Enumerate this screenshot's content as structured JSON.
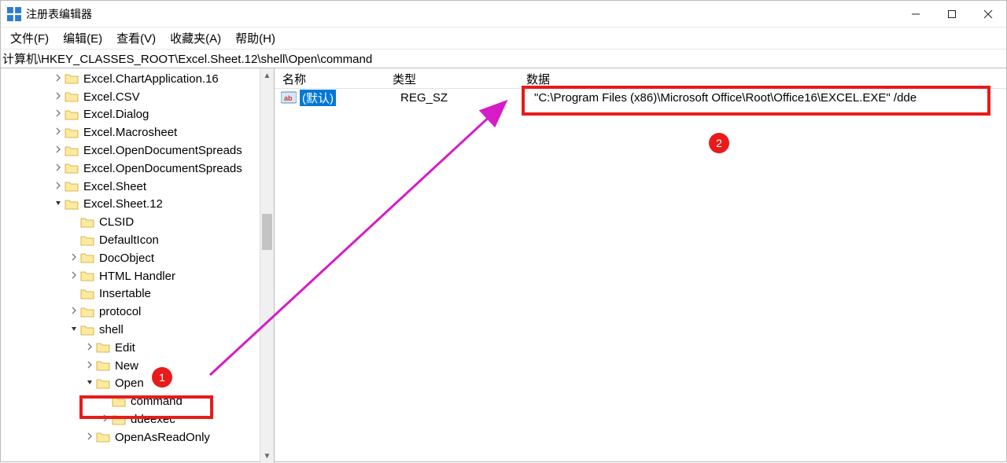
{
  "window": {
    "title": "注册表编辑器"
  },
  "menu": {
    "file": "文件(F)",
    "edit": "编辑(E)",
    "view": "查看(V)",
    "favorites": "收藏夹(A)",
    "help": "帮助(H)"
  },
  "address": {
    "path": "计算机\\HKEY_CLASSES_ROOT\\Excel.Sheet.12\\shell\\Open\\command"
  },
  "tree": [
    {
      "indent": 3,
      "arrow": ">",
      "label": "Excel.ChartApplication.16"
    },
    {
      "indent": 3,
      "arrow": ">",
      "label": "Excel.CSV"
    },
    {
      "indent": 3,
      "arrow": ">",
      "label": "Excel.Dialog"
    },
    {
      "indent": 3,
      "arrow": ">",
      "label": "Excel.Macrosheet"
    },
    {
      "indent": 3,
      "arrow": ">",
      "label": "Excel.OpenDocumentSpreads"
    },
    {
      "indent": 3,
      "arrow": ">",
      "label": "Excel.OpenDocumentSpreads"
    },
    {
      "indent": 3,
      "arrow": ">",
      "label": "Excel.Sheet"
    },
    {
      "indent": 3,
      "arrow": "v",
      "label": "Excel.Sheet.12"
    },
    {
      "indent": 4,
      "arrow": "",
      "label": "CLSID"
    },
    {
      "indent": 4,
      "arrow": "",
      "label": "DefaultIcon"
    },
    {
      "indent": 4,
      "arrow": ">",
      "label": "DocObject"
    },
    {
      "indent": 4,
      "arrow": ">",
      "label": "HTML Handler"
    },
    {
      "indent": 4,
      "arrow": "",
      "label": "Insertable"
    },
    {
      "indent": 4,
      "arrow": ">",
      "label": "protocol"
    },
    {
      "indent": 4,
      "arrow": "v",
      "label": "shell"
    },
    {
      "indent": 5,
      "arrow": ">",
      "label": "Edit"
    },
    {
      "indent": 5,
      "arrow": ">",
      "label": "New"
    },
    {
      "indent": 5,
      "arrow": "v",
      "label": "Open"
    },
    {
      "indent": 6,
      "arrow": "",
      "label": "command"
    },
    {
      "indent": 6,
      "arrow": ">",
      "label": "ddeexec"
    },
    {
      "indent": 5,
      "arrow": ">",
      "label": "OpenAsReadOnly"
    }
  ],
  "list": {
    "header": {
      "name": "名称",
      "type": "类型",
      "data": "数据"
    },
    "rows": [
      {
        "name": "(默认)",
        "type": "REG_SZ",
        "data": "\"C:\\Program Files (x86)\\Microsoft Office\\Root\\Office16\\EXCEL.EXE\" /dde"
      }
    ]
  },
  "annotations": {
    "badge1": "1",
    "badge2": "2"
  }
}
